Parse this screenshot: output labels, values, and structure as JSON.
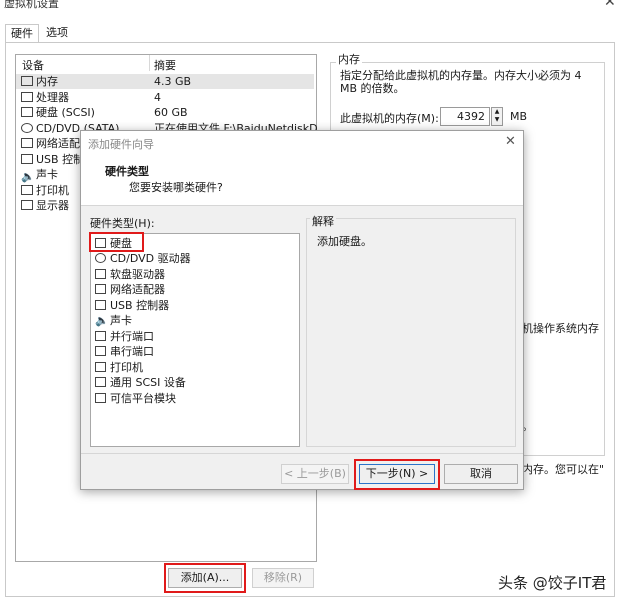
{
  "window": {
    "title": "虚拟机设置"
  },
  "tabs": [
    "硬件",
    "选项"
  ],
  "device_list": {
    "columns": [
      "设备",
      "摘要"
    ],
    "items": [
      {
        "name": "内存",
        "summary": "4.3 GB",
        "icon": "memory-icon"
      },
      {
        "name": "处理器",
        "summary": "4",
        "icon": "cpu-icon"
      },
      {
        "name": "硬盘 (SCSI)",
        "summary": "60 GB",
        "icon": "disk-icon"
      },
      {
        "name": "CD/DVD (SATA)",
        "summary": "正在使用文件 F:\\BaiduNetdiskD",
        "icon": "cd-icon"
      },
      {
        "name": "网络适配器",
        "summary": "",
        "icon": "network-icon"
      },
      {
        "name": "USB 控制器",
        "summary": "",
        "icon": "usb-icon"
      },
      {
        "name": "声卡",
        "summary": "",
        "icon": "speaker-icon"
      },
      {
        "name": "打印机",
        "summary": "",
        "icon": "printer-icon"
      },
      {
        "name": "显示器",
        "summary": "",
        "icon": "monitor-icon"
      }
    ]
  },
  "buttons": {
    "add": "添加(A)...",
    "remove": "移除(R)"
  },
  "memory_panel": {
    "group_title": "内存",
    "description": "指定分配给此虚拟机的内存量。内存大小必须为 4 MB 的倍数。",
    "label": "此虚拟机的内存(M):",
    "value": "4392",
    "unit": "MB",
    "partial_text_1": "机操作系统内存",
    "partial_text_2": "。",
    "partial_text_3": "内存。您可以在\""
  },
  "wizard": {
    "title": "添加硬件向导",
    "heading": "硬件类型",
    "subheading": "您要安装哪类硬件?",
    "list_label": "硬件类型(H):",
    "explain_label": "解释",
    "explain_text": "添加硬盘。",
    "items": [
      {
        "name": "硬盘",
        "icon": "disk-icon"
      },
      {
        "name": "CD/DVD 驱动器",
        "icon": "cd-icon"
      },
      {
        "name": "软盘驱动器",
        "icon": "floppy-icon"
      },
      {
        "name": "网络适配器",
        "icon": "network-icon"
      },
      {
        "name": "USB 控制器",
        "icon": "usb-icon"
      },
      {
        "name": "声卡",
        "icon": "speaker-icon"
      },
      {
        "name": "并行端口",
        "icon": "parallel-port-icon"
      },
      {
        "name": "串行端口",
        "icon": "serial-port-icon"
      },
      {
        "name": "打印机",
        "icon": "printer-icon"
      },
      {
        "name": "通用 SCSI 设备",
        "icon": "scsi-icon"
      },
      {
        "name": "可信平台模块",
        "icon": "tpm-icon"
      }
    ],
    "buttons": {
      "back": "< 上一步(B)",
      "next": "下一步(N) >",
      "cancel": "取消"
    }
  },
  "watermark": "头条 @饺子IT君",
  "colors": {
    "highlight": "#e01a1a",
    "selected_row": "#e5e5e5"
  }
}
